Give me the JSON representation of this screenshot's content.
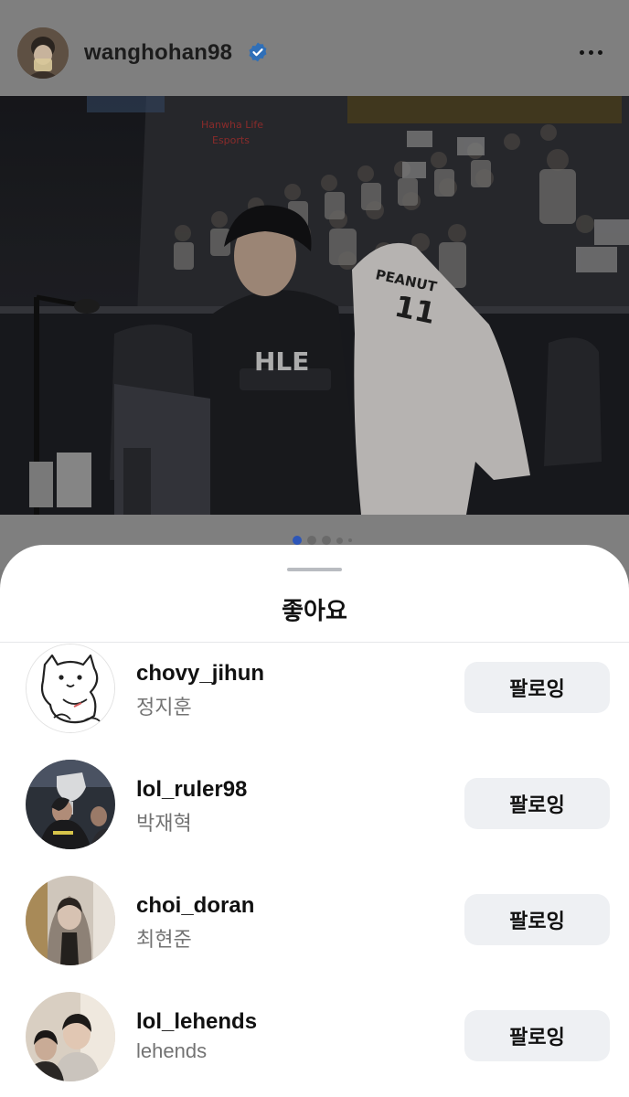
{
  "post": {
    "username": "wanghohan98",
    "verified": true,
    "more_icon": "more-horizontal-icon",
    "carousel": {
      "total": 5,
      "active": 1
    }
  },
  "sheet": {
    "title": "좋아요",
    "users": [
      {
        "username": "chovy_jihun",
        "full_name": "정지훈",
        "button": "팔로잉",
        "avatar": "cartoon-cat-avatar"
      },
      {
        "username": "lol_ruler98",
        "full_name": "박재혁",
        "button": "팔로잉",
        "avatar": "trophy-photo-avatar"
      },
      {
        "username": "choi_doran",
        "full_name": "최현준",
        "button": "팔로잉",
        "avatar": "hooded-person-avatar"
      },
      {
        "username": "lol_lehends",
        "full_name": "lehends",
        "button": "팔로잉",
        "avatar": "two-people-avatar"
      }
    ]
  },
  "colors": {
    "verified_badge": "#3897f0",
    "follow_button_bg": "#eef0f3",
    "dim_overlay": "#7f7f7f",
    "active_dot": "#2d56b8"
  }
}
